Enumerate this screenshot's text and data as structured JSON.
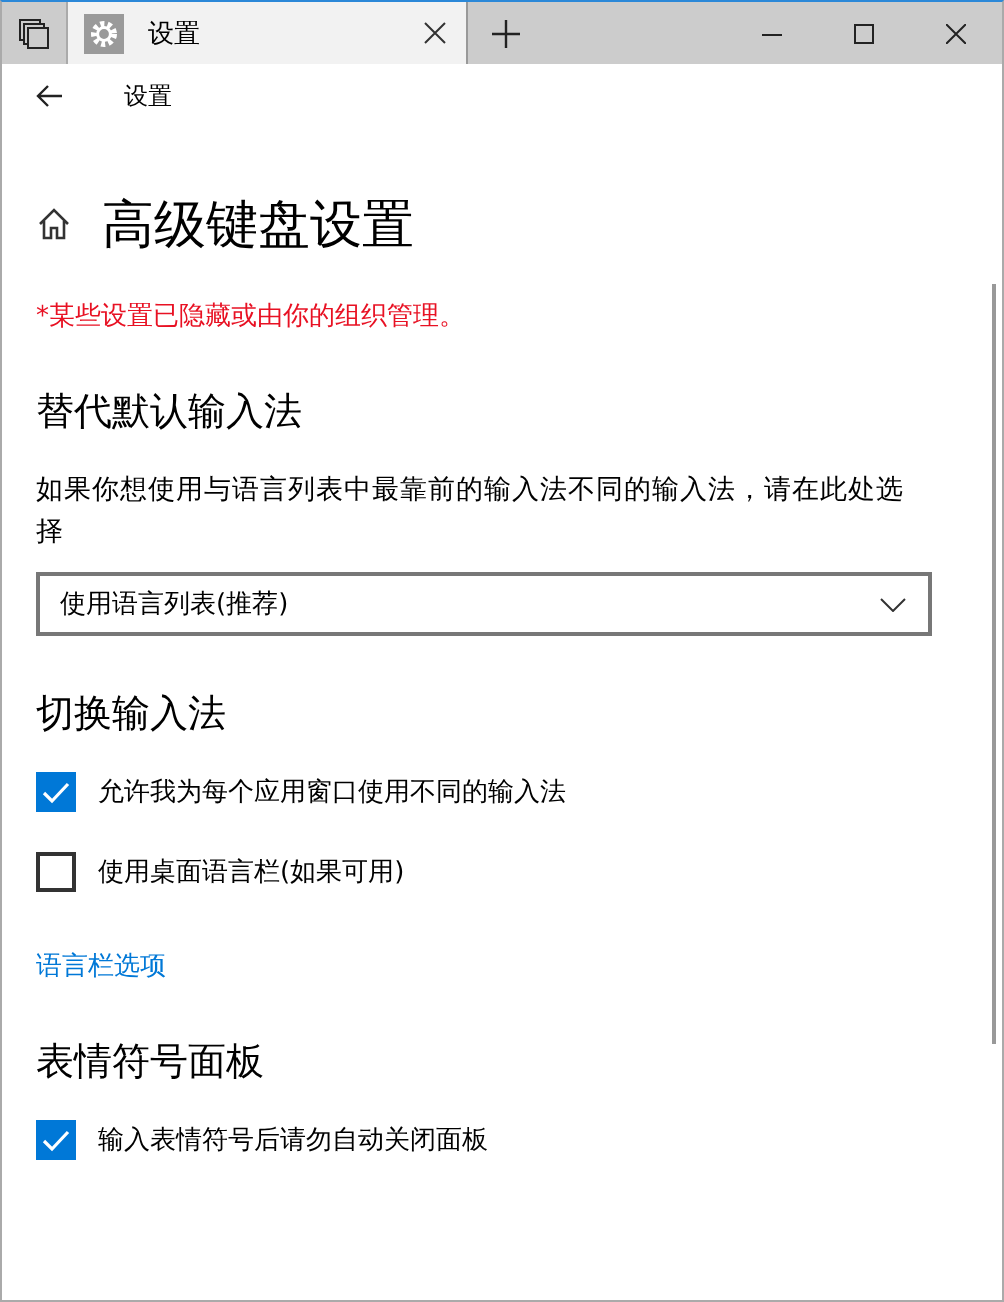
{
  "window": {
    "tab_title": "设置"
  },
  "nav": {
    "back_label": "设置"
  },
  "page": {
    "title": "高级键盘设置",
    "notice": "*某些设置已隐藏或由你的组织管理。",
    "sections": [
      {
        "heading": "替代默认输入法",
        "items": [
          {
            "kind": "description",
            "text": "如果你想使用与语言列表中最靠前的输入法不同的输入法，请在此处选择"
          },
          {
            "kind": "dropdown",
            "value": "使用语言列表(推荐)"
          }
        ]
      },
      {
        "heading": "切换输入法",
        "items": [
          {
            "kind": "checkbox",
            "label": "允许我为每个应用窗口使用不同的输入法",
            "checked": true
          },
          {
            "kind": "checkbox",
            "label": "使用桌面语言栏(如果可用)",
            "checked": false
          },
          {
            "kind": "link",
            "text": "语言栏选项"
          }
        ]
      },
      {
        "heading": "表情符号面板",
        "items": [
          {
            "kind": "checkbox",
            "label": "输入表情符号后请勿自动关闭面板",
            "checked": true
          }
        ]
      }
    ]
  }
}
